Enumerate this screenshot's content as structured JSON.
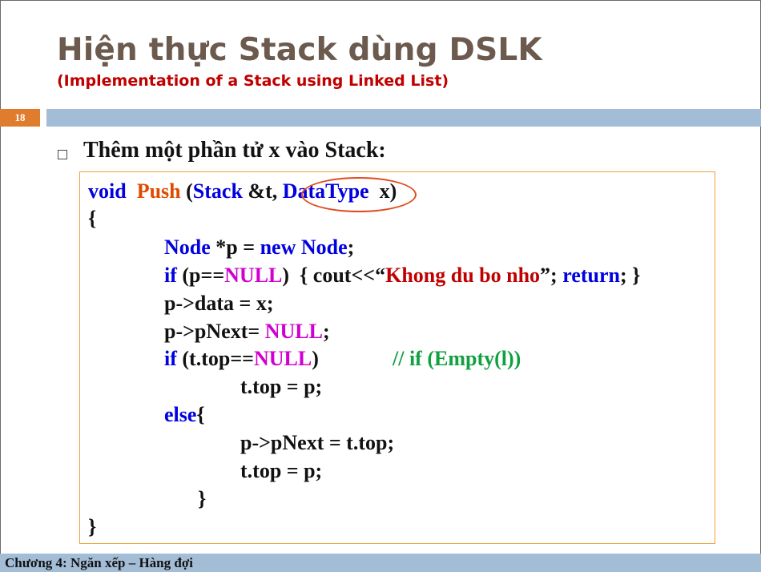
{
  "slide": {
    "title": "Hiện thực Stack dùng DSLK",
    "subtitle": "(Implementation of a Stack using Linked List)",
    "number": "18",
    "bullet_heading": "Thêm một phần tử x vào Stack:",
    "footer": "Chương 4: Ngăn xếp – Hàng đợi"
  },
  "code": {
    "l1": {
      "a": "void",
      "b": "Push",
      "c": "(",
      "d": "Stack",
      "e": " &t, ",
      "f": "DataType",
      "g": "  x)"
    },
    "l2": {
      "a": "{"
    },
    "l3": {
      "a": "Node",
      "b": " *p = ",
      "c": "new",
      "d": " Node",
      "e": ";"
    },
    "l4": {
      "a": "if",
      "b": " (p==",
      "c": "NULL",
      "d": ")  { cout<<“",
      "e": "Khong du bo nho",
      "f": "”; ",
      "g": "return",
      "h": "; }"
    },
    "l5": {
      "a": "p->data = x;"
    },
    "l6": {
      "a": "p->pNext= ",
      "b": "NULL",
      "c": ";"
    },
    "l7": {
      "a": "if",
      "b": " (t.top==",
      "c": "NULL",
      "d": ")",
      "e": "// if (Empty(l))"
    },
    "l8": {
      "a": "t.top = p;"
    },
    "l9": {
      "a": "else",
      "b": "{"
    },
    "l10": {
      "a": "p->pNext = t.top;"
    },
    "l11": {
      "a": "t.top = p;"
    },
    "l12": {
      "a": "}"
    },
    "l13": {
      "a": "}"
    }
  },
  "colors": {
    "title": "#6b5a4d",
    "subtitle": "#c00000",
    "keyword": "#0000e0",
    "function_name": "#e04a00",
    "null_literal": "#d000d0",
    "string": "#c00000",
    "comment": "#10a040",
    "header_bar": "#a4bdd6",
    "slide_number_bg": "#e07c2e",
    "code_border": "#f0a33a",
    "highlight_ellipse": "#e04a20"
  }
}
